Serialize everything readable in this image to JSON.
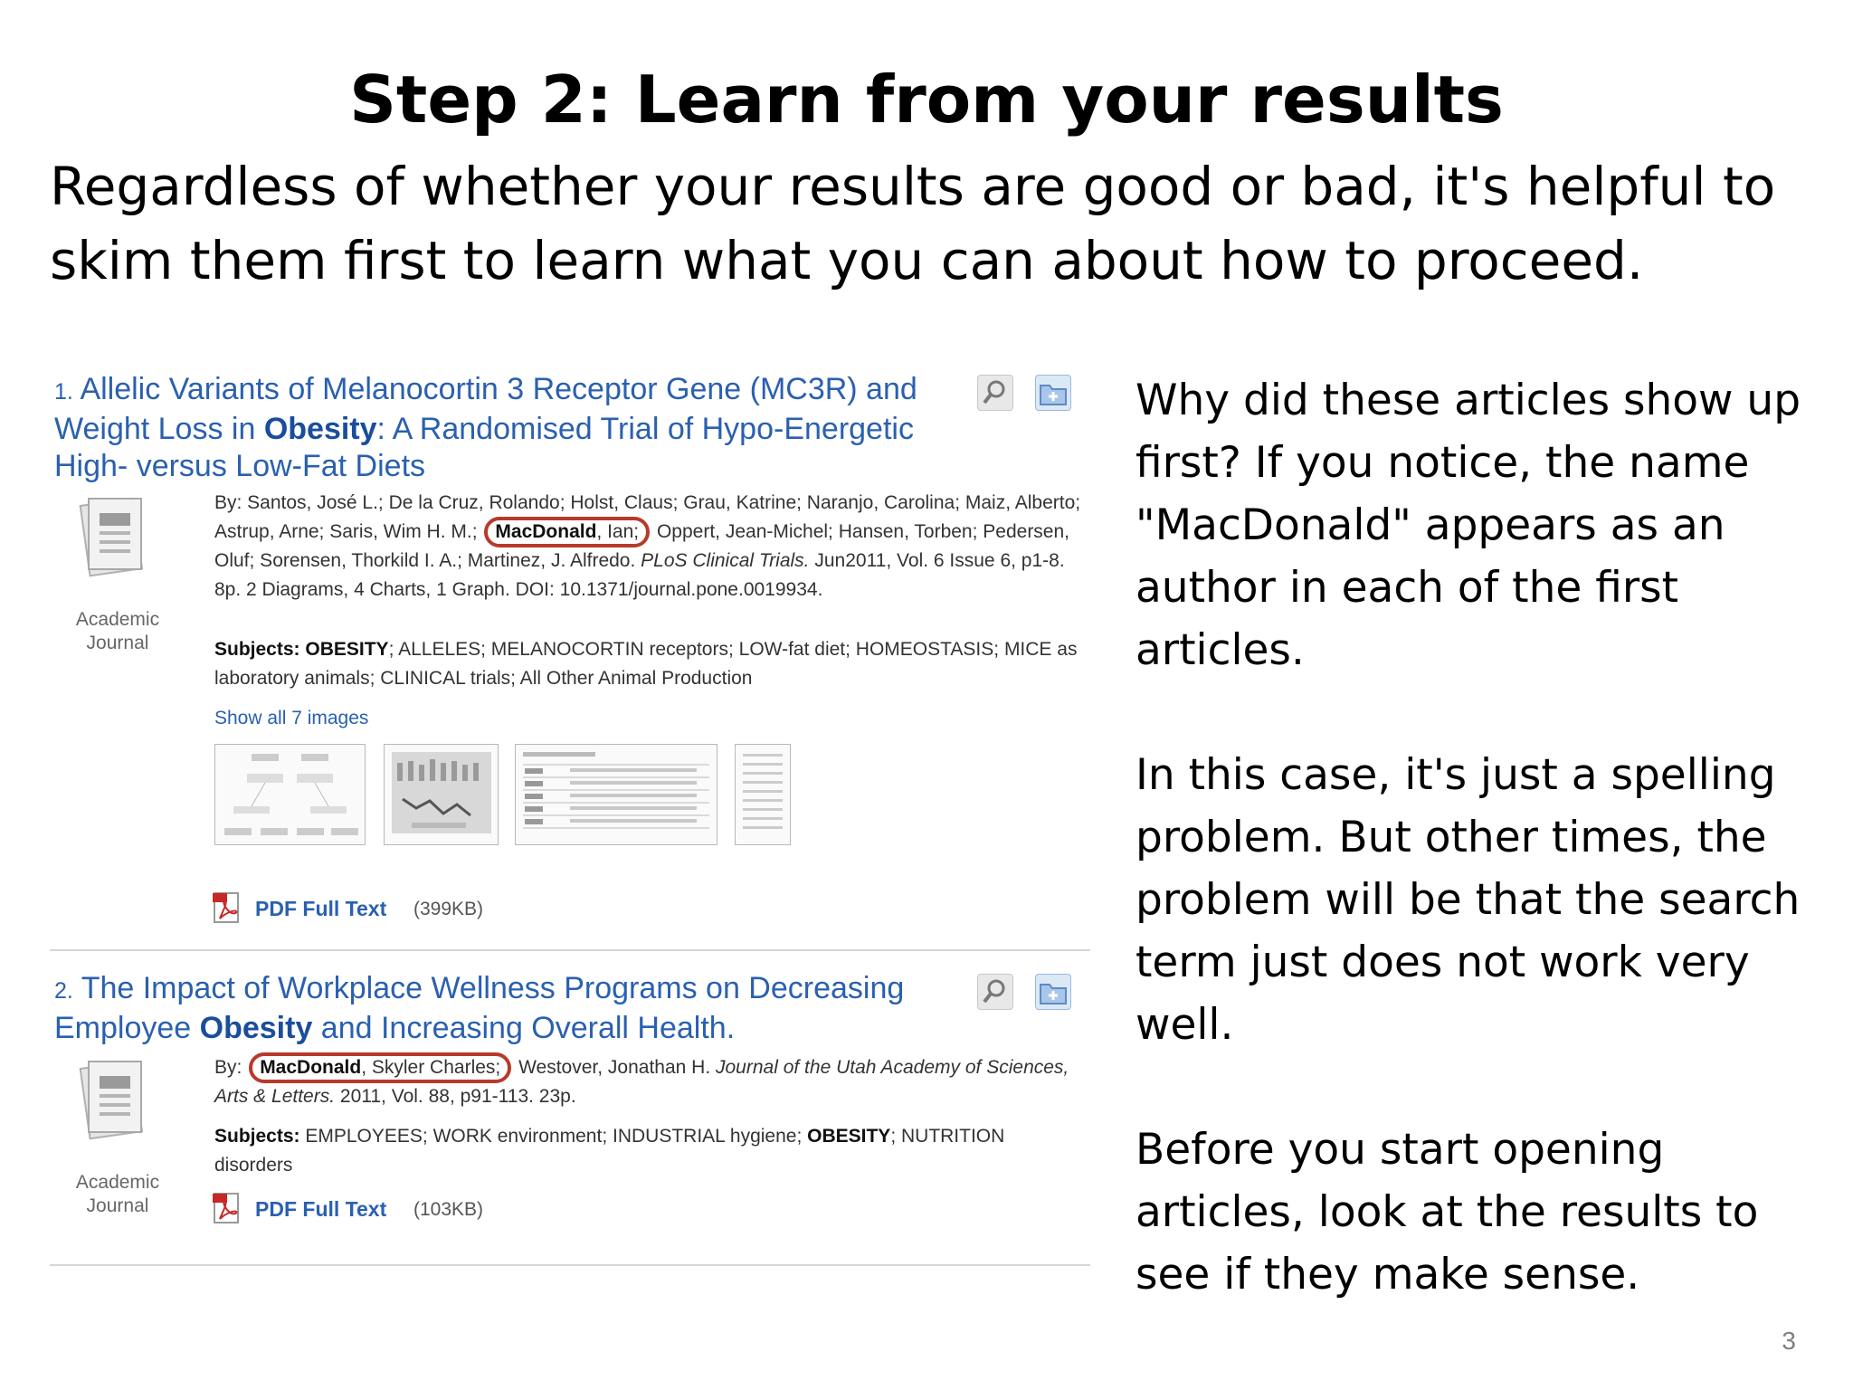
{
  "slide": {
    "title": "Step 2: Learn from your results",
    "intro": "Regardless of whether your results are good or bad, it's helpful to skim them first to learn what you can about how to proceed.",
    "page_number": "3"
  },
  "side_notes": [
    "Why did these articles show up first? If you notice, the name \"MacDonald\" appears as an author in each of the first articles.",
    "In this case, it's just a spelling problem. But other times, the problem will be that the search term just does not work very well.",
    "Before you start opening articles, look at the results to see if they make sense."
  ],
  "results": [
    {
      "number": "1.",
      "title_pre": "Allelic Variants of Melanocortin 3 Receptor Gene (MC3R) and Weight Loss in ",
      "title_bold": "Obesity",
      "title_post": ": A Randomised Trial of Hypo-Energetic High- versus Low-Fat Diets",
      "type_label_1": "Academic",
      "type_label_2": "Journal",
      "authors_pre": "By: Santos, José L.; De la Cruz, Rolando; Holst, Claus; Grau, Katrine; Naranjo, Carolina; Maiz, Alberto; Astrup, Arne; Saris, Wim H. M.;",
      "authors_hl_bold": "MacDonald",
      "authors_hl_rest": ", Ian;",
      "authors_post": "Oppert, Jean-Michel; Hansen, Torben; Pedersen, Oluf; Sorensen, Thorkild I. A.; Martinez, J. Alfredo.",
      "journal": "PLoS Clinical Trials.",
      "details": "Jun2011, Vol. 6 Issue 6, p1-8. 8p. 2 Diagrams, 4 Charts, 1 Graph. DOI: 10.1371/journal.pone.0019934.",
      "subjects_label": "Subjects:",
      "subjects_bold_1": "OBESITY",
      "subjects_text": "; ALLELES; MELANOCORTIN receptors; LOW-fat diet; HOMEOSTASIS; MICE as laboratory animals; CLINICAL trials; All Other Animal Production",
      "show_images": "Show all 7 images",
      "pdf_label": "PDF Full Text",
      "pdf_size": "(399KB)"
    },
    {
      "number": "2.",
      "title_pre": "The Impact of Workplace Wellness Programs on Decreasing Employee ",
      "title_bold": "Obesity",
      "title_post": " and Increasing Overall Health.",
      "type_label_1": "Academic",
      "type_label_2": "Journal",
      "authors_pre": "By:",
      "authors_hl_bold": "MacDonald",
      "authors_hl_rest": ", Skyler Charles;",
      "authors_post": "Westover, Jonathan H.",
      "journal": "Journal of the Utah Academy of Sciences, Arts & Letters.",
      "details": "2011, Vol. 88, p91-113. 23p.",
      "subjects_label": "Subjects:",
      "subjects_text_a": "EMPLOYEES; WORK environment; INDUSTRIAL hygiene; ",
      "subjects_bold_1": "OBESITY",
      "subjects_text_b": "; NUTRITION disorders",
      "pdf_label": "PDF Full Text",
      "pdf_size": "(103KB)"
    }
  ],
  "colors": {
    "link": "#2a60b0",
    "highlight_circle": "#b83a2a",
    "slide_number": "#7f7f7f"
  },
  "icons": {
    "preview": "magnifier-icon",
    "folder": "add-to-folder-icon",
    "doc": "academic-journal-icon",
    "pdf": "pdf-icon"
  }
}
